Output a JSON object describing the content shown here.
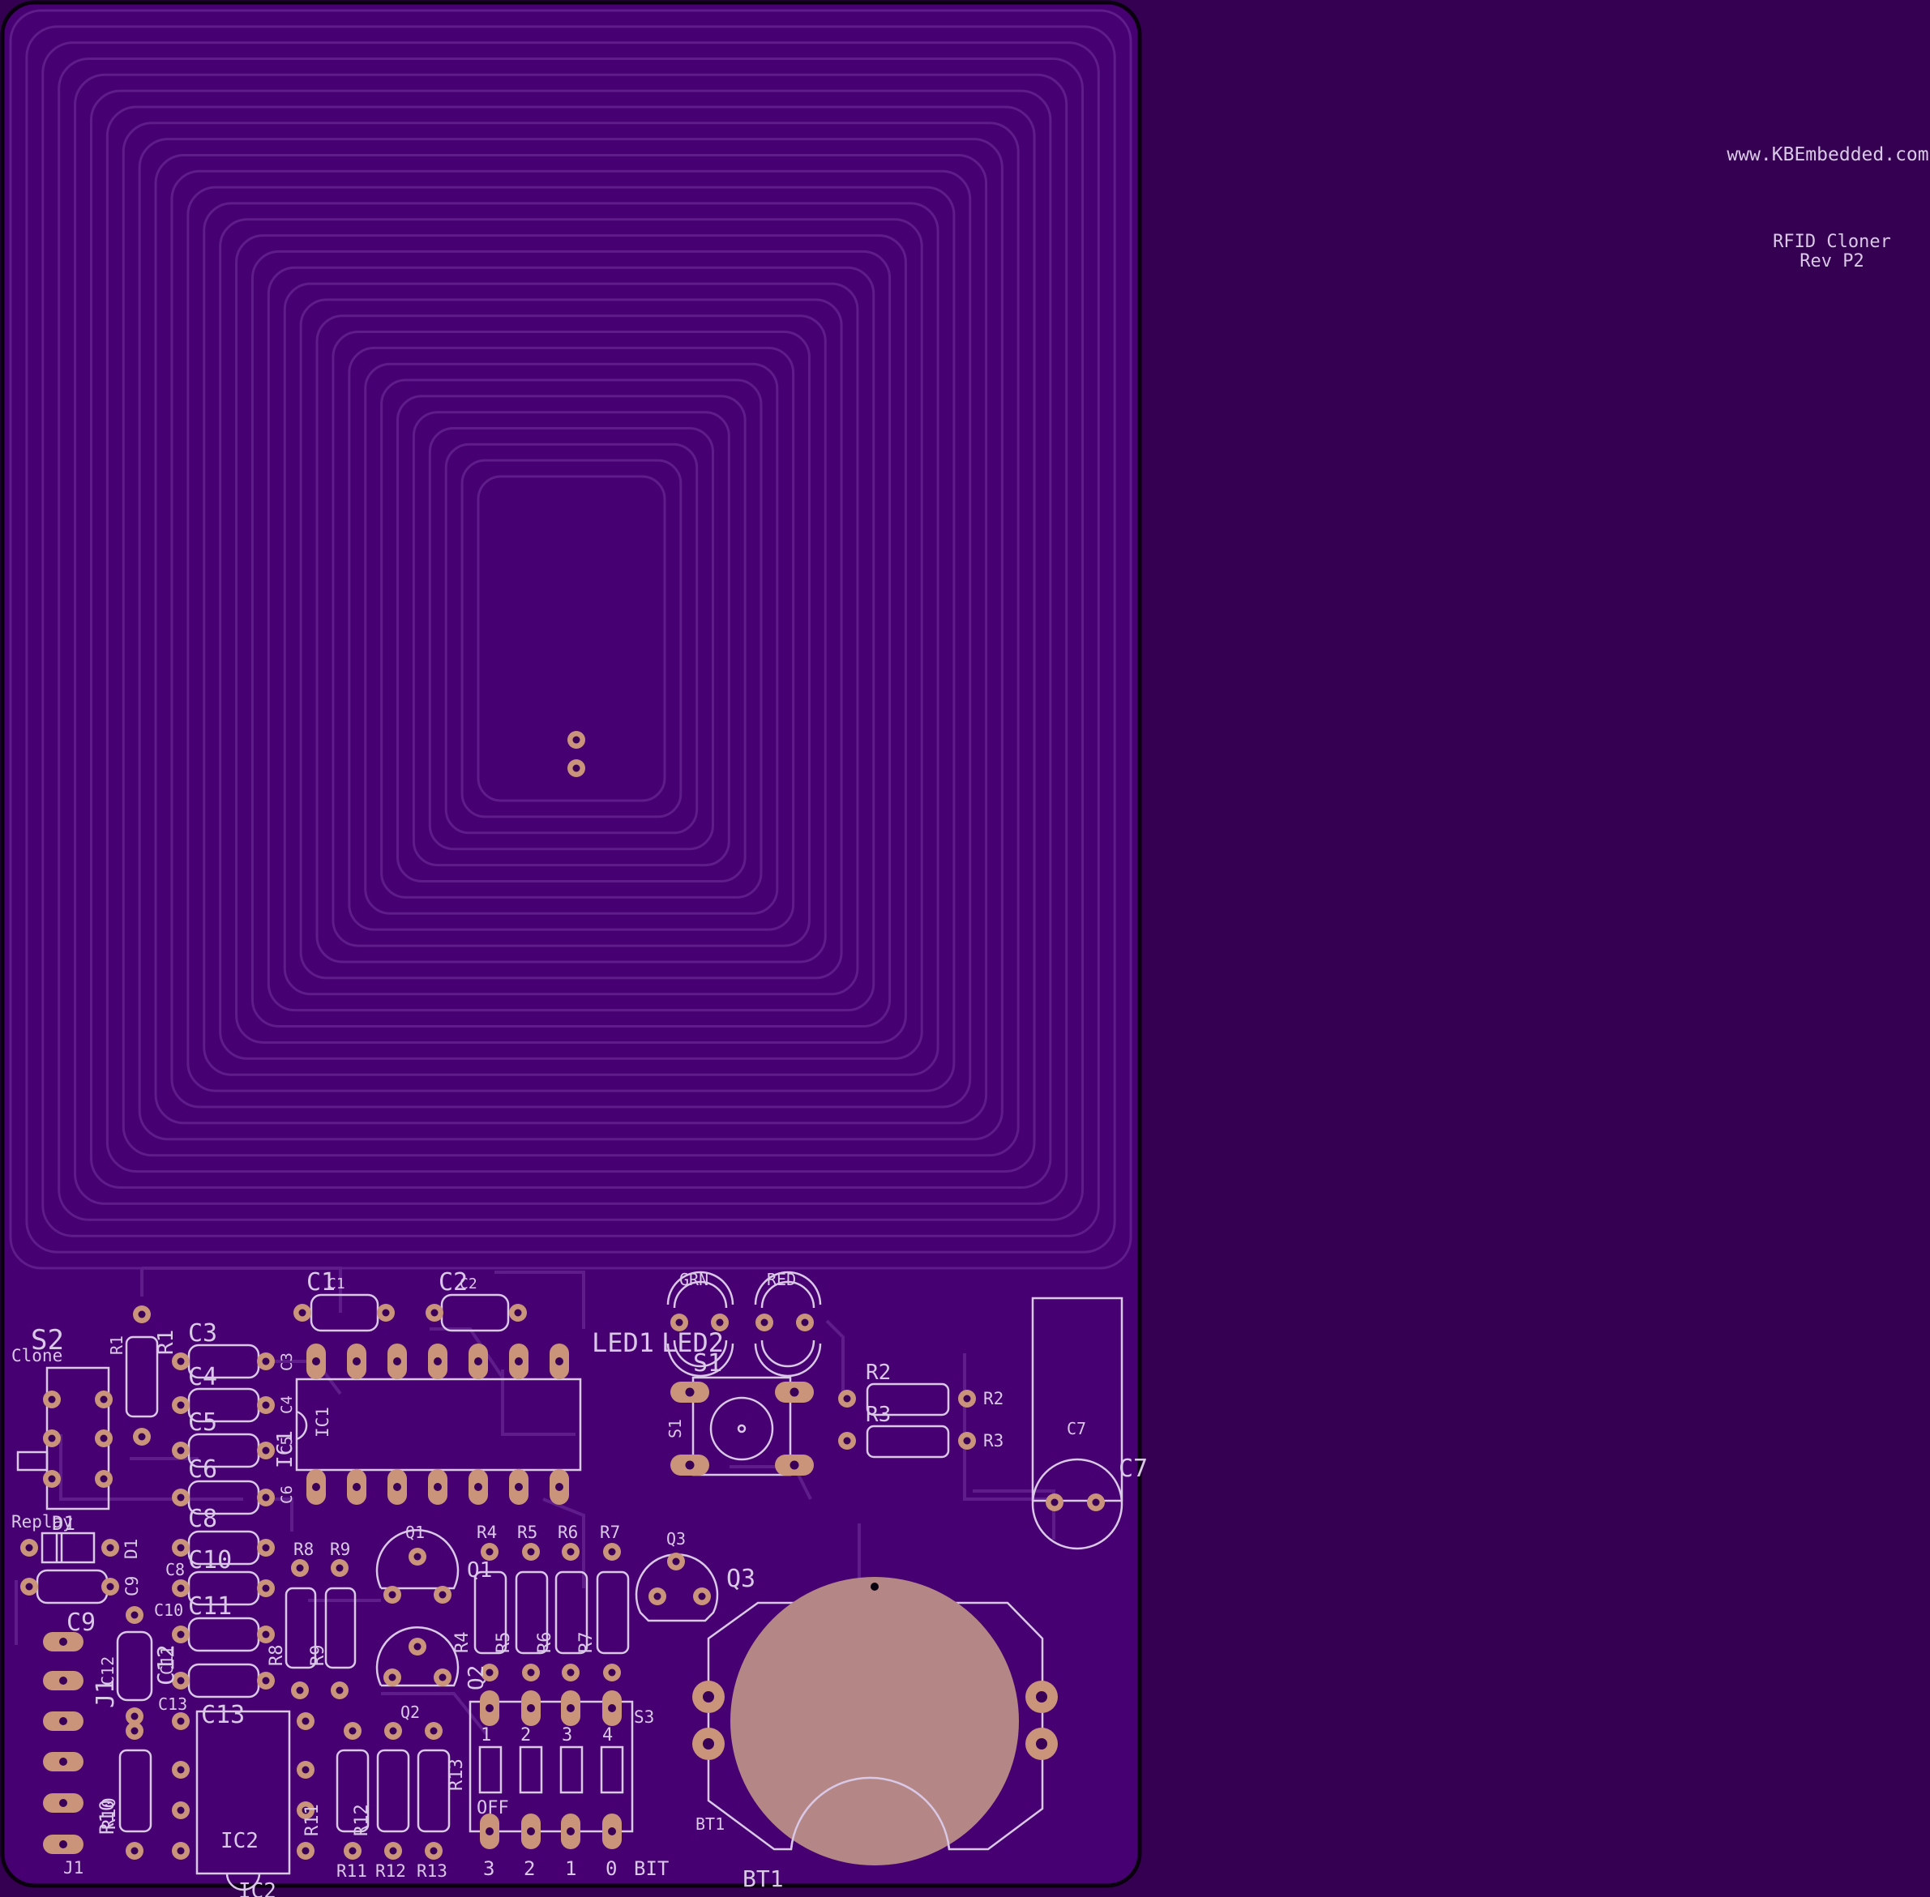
{
  "board": {
    "website": "www.KBEmbedded.com",
    "title": "RFID Cloner",
    "revision": "Rev P2"
  },
  "colors": {
    "background": "#350052",
    "board": "#470071",
    "silkscreen": "#d9c8e6",
    "copper": "#c9947a",
    "pad_hole": "#3a0057",
    "outline": "#0a0010",
    "trace": "#5e1d8a"
  },
  "labels": {
    "C1": "C1",
    "C1s": "C1",
    "C2": "C2",
    "C2s": "C2",
    "GRN": "GRN",
    "RED": "RED",
    "LED1": "LED1",
    "LED2": "LED2",
    "S1": "S1",
    "S1s": "S1",
    "R2": "R2",
    "R2s": "R2",
    "R3": "R3",
    "R3s": "R3",
    "C7": "C7",
    "C7s": "C7",
    "S2": "S2",
    "Clone": "Clone",
    "Replay": "Replay",
    "R1": "R1",
    "R1s": "R1",
    "C3": "C3",
    "C3s": "C3",
    "C4": "C4",
    "C4s": "C4",
    "C5": "C5",
    "C5s": "C5",
    "C6": "C6",
    "C6s": "C6",
    "C8": "C8",
    "C8s": "C8",
    "C9": "C9",
    "C9s": "C9",
    "C10": "C10",
    "C10s": "C10",
    "C11": "C11",
    "C11s": "C11",
    "C12": "C12",
    "C12s": "C12",
    "C13": "C13",
    "C13s": "C13",
    "IC1": "IC1",
    "IC1s": "IC1",
    "IC2": "IC2",
    "IC2s": "IC2",
    "D1": "D1",
    "D1s": "D1",
    "J1": "J1",
    "J1s": "J1",
    "R4": "R4",
    "R5": "R5",
    "R6": "R6",
    "R7": "R7",
    "R4s": "R4",
    "R5s": "R5",
    "R6s": "R6",
    "R7s": "R7",
    "R8": "R8",
    "R9": "R9",
    "R8s": "R8",
    "R9s": "R9",
    "R10": "R10",
    "R10s": "R10",
    "R11": "R11",
    "R12": "R12",
    "R13": "R13",
    "R11s": "R11",
    "R12s": "R12",
    "R13s": "R13",
    "Q1": "Q1",
    "Q1s": "Q1",
    "Q2": "Q2",
    "Q2s": "Q2",
    "Q3": "Q3",
    "Q3s": "Q3",
    "S3": "S3",
    "sw1": "1",
    "sw2": "2",
    "sw3": "3",
    "sw4": "4",
    "OFF": "OFF",
    "bit3": "3",
    "bit2": "2",
    "bit1": "1",
    "bit0": "0",
    "BIT": "BIT",
    "BT1": "BT1",
    "BT1s": "BT1"
  }
}
